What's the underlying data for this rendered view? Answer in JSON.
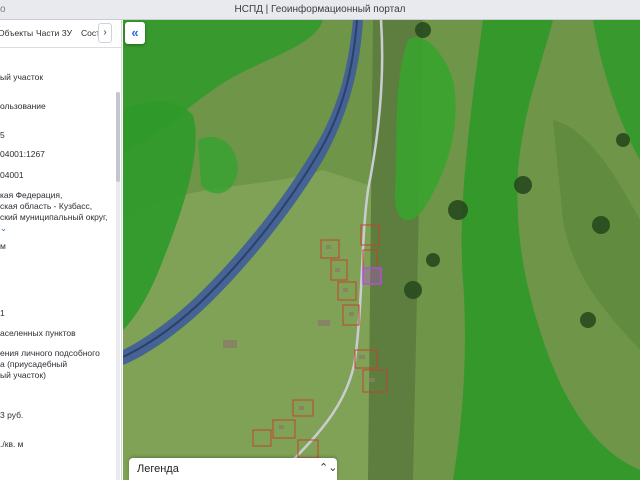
{
  "window": {
    "url_fragment": "o",
    "title": "НСПД | Геоинформационный портал"
  },
  "panel": {
    "tabs": [
      "Объекты",
      "Части ЗУ",
      "Соста"
    ],
    "tab_next_icon": "chevron-right-icon",
    "rows": [
      {
        "text": "ый участок"
      },
      {
        "text": "ользование"
      },
      {
        "text": "5"
      },
      {
        "text": "04001:1267"
      },
      {
        "text": "04001"
      },
      {
        "text": "кая Федерация,"
      },
      {
        "text": "ская область - Кузбасс,"
      },
      {
        "text": "ский муниципальный округ,"
      },
      {
        "text": "",
        "more": "⌄"
      },
      {
        "text": "м"
      },
      {
        "text": "1"
      },
      {
        "text": "аселенных пунктов"
      },
      {
        "text": "ения личного подсобного"
      },
      {
        "text": "а (приусадебный"
      },
      {
        "text": "ый участок)"
      },
      {
        "text": "3 руб."
      },
      {
        "text": "./кв. м"
      }
    ]
  },
  "map": {
    "collapse_icon": "double-chevron-left-icon",
    "legend_label": "Легенда",
    "legend_icon": "chevron-updown-icon",
    "colors": {
      "meadow": "#6f9548",
      "forest_zone": "#2f9a2a",
      "river_zone": "#3f5c9a",
      "road": "#c9cdd2",
      "parcel_border": "#c0442e",
      "selected_parcel": "#b44ed8"
    }
  }
}
